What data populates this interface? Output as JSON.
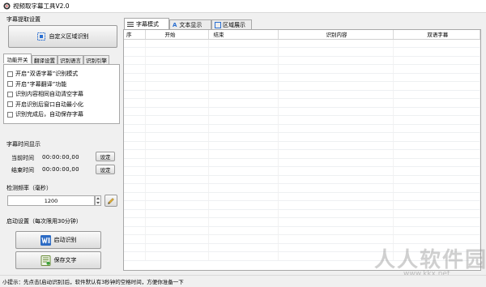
{
  "window": {
    "title": "视频取字幕工具V2.0"
  },
  "extract_group": {
    "label": "字幕提取设置",
    "custom_region_button": "自定义区域识别"
  },
  "settings_tabs": [
    {
      "label": "功能开关",
      "active": true
    },
    {
      "label": "翻译设置",
      "active": false
    },
    {
      "label": "识别语言",
      "active": false
    },
    {
      "label": "识别引擎",
      "active": false
    }
  ],
  "options": [
    {
      "label": "开启“双语字幕”识别模式",
      "checked": false
    },
    {
      "label": "开启“字幕翻译”功能",
      "checked": false
    },
    {
      "label": "识别内容相同自动清空字幕",
      "checked": false
    },
    {
      "label": "开启识别后窗口自动最小化",
      "checked": false
    },
    {
      "label": "识别完成后，自动保存字幕",
      "checked": false
    }
  ],
  "time_group": {
    "label": "字幕时间显示",
    "current_label": "当前时间",
    "current_value": "00:00:00,00",
    "end_label": "结束时间",
    "end_value": "00:00:00,00",
    "set_button": "设定"
  },
  "frequency": {
    "label": "检测频率（毫秒）",
    "value": "1200"
  },
  "start_group": {
    "label": "启动设置（每次限用30分钟）",
    "start_button": "启动识别",
    "save_button": "保存文字"
  },
  "right_tabs": [
    {
      "label": "字幕模式",
      "active": true,
      "icon": "list-icon"
    },
    {
      "label": "文本显示",
      "active": false,
      "icon": "text-icon"
    },
    {
      "label": "区域展示",
      "active": false,
      "icon": "region-icon"
    }
  ],
  "table": {
    "columns": [
      "序",
      "开始",
      "结束",
      "识别内容",
      "双语字幕"
    ],
    "rows": []
  },
  "status_bar": {
    "text": "小提示：先点击[启动识别]后，软件默认有3秒钟的空格时间，方便你准备一下"
  },
  "watermark": {
    "text": "人人软件园",
    "url": "www.kkx.net"
  }
}
